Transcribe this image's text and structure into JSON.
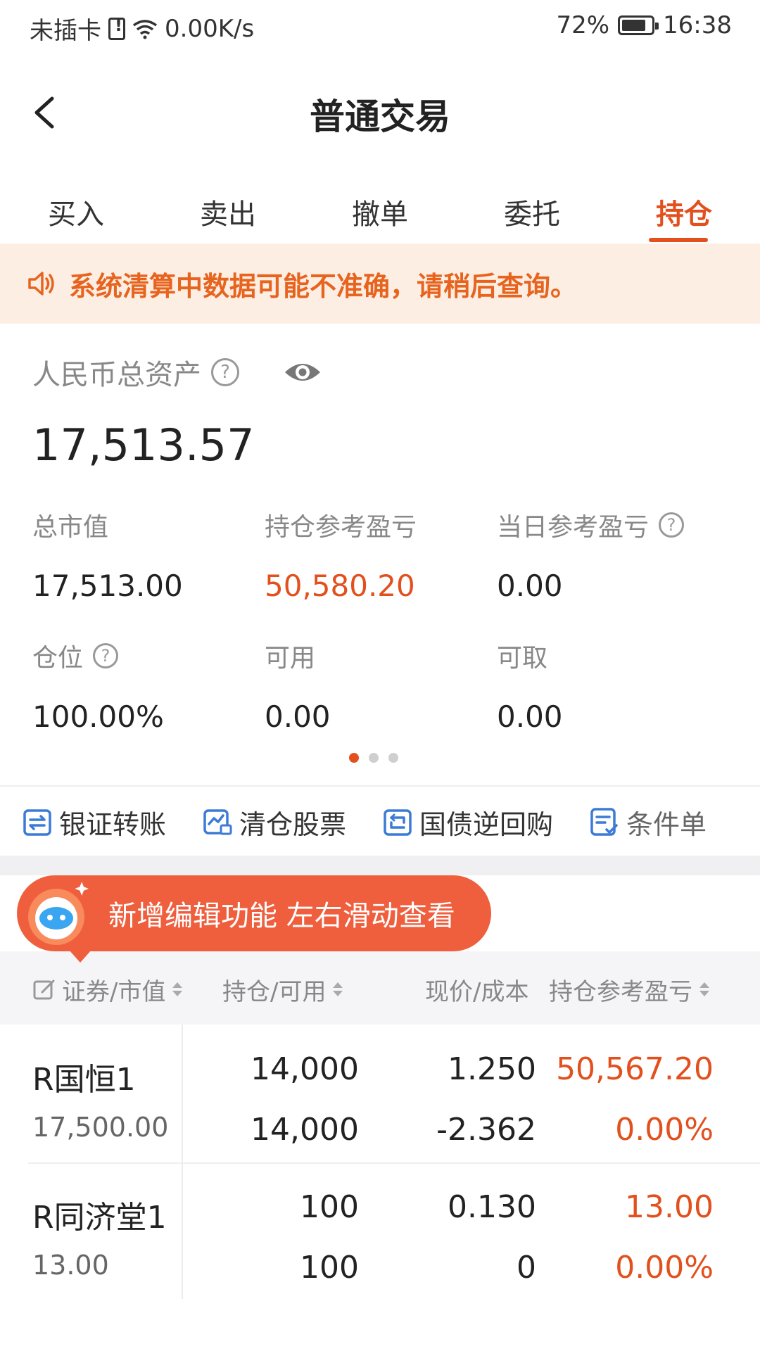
{
  "status_bar": {
    "carrier": "未插卡",
    "speed": "0.00K/s",
    "battery": "72%",
    "time": "16:38"
  },
  "header": {
    "title": "普通交易"
  },
  "tabs": [
    {
      "label": "买入",
      "active": false
    },
    {
      "label": "卖出",
      "active": false
    },
    {
      "label": "撤单",
      "active": false
    },
    {
      "label": "委托",
      "active": false
    },
    {
      "label": "持仓",
      "active": true
    }
  ],
  "notice": {
    "text": "系统清算中数据可能不准确，请稍后查询。"
  },
  "assets": {
    "label": "人民币总资产",
    "total": "17,513.57",
    "stats": [
      {
        "label": "总市值",
        "value": "17,513.00"
      },
      {
        "label": "持仓参考盈亏",
        "value": "50,580.20"
      },
      {
        "label": "当日参考盈亏",
        "value": "0.00"
      },
      {
        "label": "仓位",
        "value": "100.00%"
      },
      {
        "label": "可用",
        "value": "0.00"
      },
      {
        "label": "可取",
        "value": "0.00"
      }
    ]
  },
  "shortcuts": [
    {
      "label": "银证转账",
      "icon": "transfer-icon"
    },
    {
      "label": "清仓股票",
      "icon": "clear-stock-icon"
    },
    {
      "label": "国债逆回购",
      "icon": "reverse-repo-icon"
    },
    {
      "label": "条件单",
      "icon": "condition-order-icon"
    }
  ],
  "promo": {
    "text": "新增编辑功能 左右滑动查看"
  },
  "table": {
    "headers": [
      "证券/市值",
      "持仓/可用",
      "现价/成本",
      "持仓参考盈亏"
    ],
    "rows": [
      {
        "name": "R国恒1",
        "market_value": "17,500.00",
        "position": "14,000",
        "available": "14,000",
        "price": "1.250",
        "cost": "-2.362",
        "pnl": "50,567.20",
        "pnl_pct": "0.00%"
      },
      {
        "name": "R同济堂1",
        "market_value": "13.00",
        "position": "100",
        "available": "100",
        "price": "0.130",
        "cost": "0",
        "pnl": "13.00",
        "pnl_pct": "0.00%"
      }
    ]
  },
  "colors": {
    "accent": "#e2501d",
    "notice_bg": "#fdeee4",
    "notice_text": "#e7641f",
    "promo_bg": "#ef5f3e"
  }
}
